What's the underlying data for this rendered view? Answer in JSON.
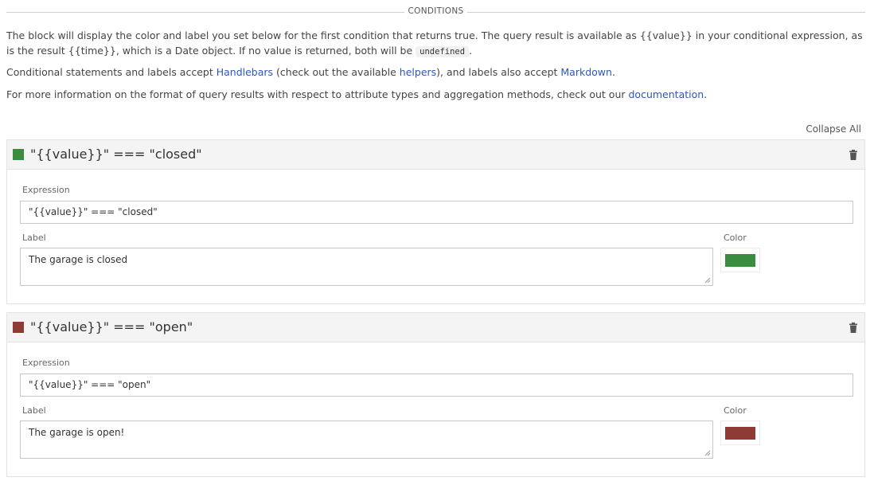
{
  "section_title": "CONDITIONS",
  "intro": {
    "p1": {
      "text_a": "The block will display the color and label you set below for the first condition that returns true. The query result is available as {{value}} in your conditional expression, as is the result {{time}}, which is a Date object. If no value is returned, both will be ",
      "code": "undefined",
      "text_b": "."
    },
    "p2": {
      "text_a": "Conditional statements and labels accept ",
      "link1": "Handlebars",
      "text_b": " (check out the available ",
      "link2": "helpers",
      "text_c": "), and labels also accept ",
      "link3": "Markdown",
      "text_d": "."
    },
    "p3": {
      "text_a": "For more information on the format of query results with respect to attribute types and aggregation methods, check out our ",
      "link": "documentation",
      "text_b": "."
    }
  },
  "collapse_all_label": "Collapse All",
  "field_labels": {
    "expression": "Expression",
    "label": "Label",
    "color": "Color"
  },
  "conditions": [
    {
      "title": "\"{{value}}\" === \"closed\"",
      "expression": "\"{{value}}\" === \"closed\"",
      "label": "The garage is closed",
      "color": "#3a8c3f"
    },
    {
      "title": "\"{{value}}\" === \"open\"",
      "expression": "\"{{value}}\" === \"open\"",
      "label": "The garage is open!",
      "color": "#8e3a35"
    }
  ],
  "icons": {
    "delete": "trash-icon"
  }
}
